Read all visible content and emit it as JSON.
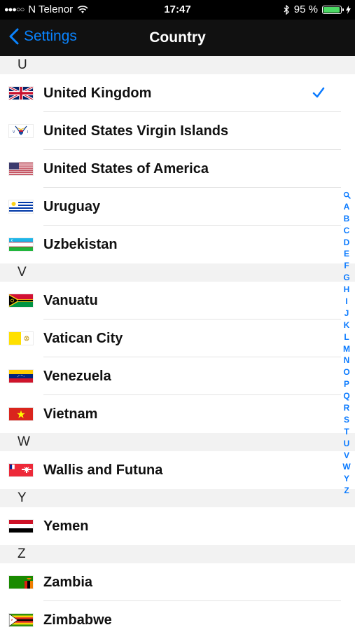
{
  "status": {
    "signal_dots": "●●●○○",
    "carrier": "N Telenor",
    "time": "17:47",
    "battery": "95 %",
    "battery_level": 0.95
  },
  "nav": {
    "back_label": "Settings",
    "title": "Country"
  },
  "colors": {
    "accent": "#0a7aff",
    "nav_bg": "#111111",
    "battery_fill": "#4cd964"
  },
  "sections": [
    {
      "letter": "U",
      "countries": [
        {
          "name": "United Kingdom",
          "flag": "uk-flag-icon",
          "selected": true
        },
        {
          "name": "United States Virgin Islands",
          "flag": "usvi-flag-icon"
        },
        {
          "name": "United States of America",
          "flag": "usa-flag-icon"
        },
        {
          "name": "Uruguay",
          "flag": "uruguay-flag-icon"
        },
        {
          "name": "Uzbekistan",
          "flag": "uzbekistan-flag-icon"
        }
      ]
    },
    {
      "letter": "V",
      "countries": [
        {
          "name": "Vanuatu",
          "flag": "vanuatu-flag-icon"
        },
        {
          "name": "Vatican City",
          "flag": "vatican-flag-icon"
        },
        {
          "name": "Venezuela",
          "flag": "venezuela-flag-icon"
        },
        {
          "name": "Vietnam",
          "flag": "vietnam-flag-icon"
        }
      ]
    },
    {
      "letter": "W",
      "countries": [
        {
          "name": "Wallis and Futuna",
          "flag": "wallis-futuna-flag-icon"
        }
      ]
    },
    {
      "letter": "Y",
      "countries": [
        {
          "name": "Yemen",
          "flag": "yemen-flag-icon"
        }
      ]
    },
    {
      "letter": "Z",
      "countries": [
        {
          "name": "Zambia",
          "flag": "zambia-flag-icon"
        },
        {
          "name": "Zimbabwe",
          "flag": "zimbabwe-flag-icon"
        }
      ]
    }
  ],
  "index": [
    "search",
    "A",
    "B",
    "C",
    "D",
    "E",
    "F",
    "G",
    "H",
    "I",
    "J",
    "K",
    "L",
    "M",
    "N",
    "O",
    "P",
    "Q",
    "R",
    "S",
    "T",
    "U",
    "V",
    "W",
    "Y",
    "Z"
  ]
}
